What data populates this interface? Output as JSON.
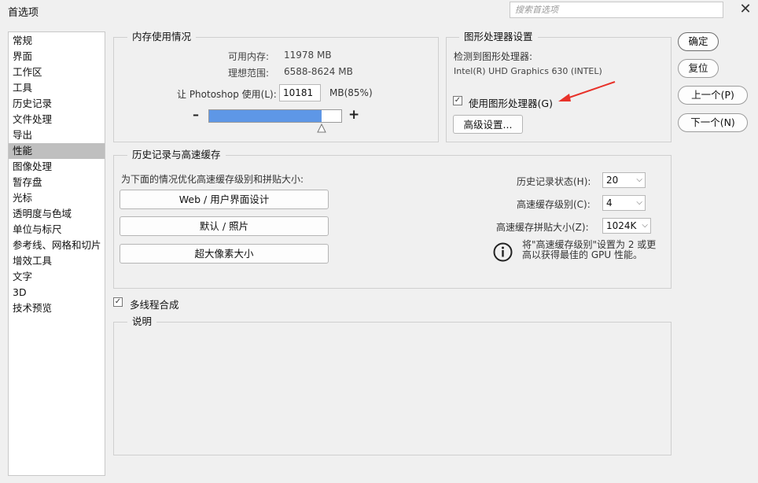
{
  "window": {
    "title": "首选项",
    "search_placeholder": "搜索首选项",
    "close_glyph": "✕"
  },
  "sidebar": {
    "items": [
      {
        "label": "常规"
      },
      {
        "label": "界面"
      },
      {
        "label": "工作区"
      },
      {
        "label": "工具"
      },
      {
        "label": "历史记录"
      },
      {
        "label": "文件处理"
      },
      {
        "label": "导出"
      },
      {
        "label": "性能",
        "selected": true
      },
      {
        "label": "图像处理"
      },
      {
        "label": "暂存盘"
      },
      {
        "label": "光标"
      },
      {
        "label": "透明度与色域"
      },
      {
        "label": "单位与标尺"
      },
      {
        "label": "参考线、网格和切片"
      },
      {
        "label": "增效工具"
      },
      {
        "label": "文字"
      },
      {
        "label": "3D"
      },
      {
        "label": "技术预览"
      }
    ]
  },
  "memory": {
    "title": "内存使用情况",
    "available_label": "可用内存:",
    "available_value": "11978 MB",
    "ideal_label": "理想范围:",
    "ideal_value": "6588-8624 MB",
    "let_label": "让 Photoshop 使用(L):",
    "let_value": "10181",
    "let_unit": "MB(85%)",
    "slider_fraction": 0.85,
    "minus": "–",
    "plus": "+"
  },
  "gpu": {
    "title": "图形处理器设置",
    "detected_label": "检测到图形处理器:",
    "gpu_name": "Intel(R) UHD Graphics 630 (INTEL)",
    "use_gpu_label": "使用图形处理器(G)",
    "use_gpu_checked": true,
    "advanced_button": "高级设置..."
  },
  "history_cache": {
    "title": "历史记录与高速缓存",
    "optimize_label": "为下面的情况优化高速缓存级别和拼贴大小:",
    "buttons": [
      "Web / 用户界面设计",
      "默认 / 照片",
      "超大像素大小"
    ],
    "history_states_label": "历史记录状态(H):",
    "history_states_value": "20",
    "cache_levels_label": "高速缓存级别(C):",
    "cache_levels_value": "4",
    "cache_tile_label": "高速缓存拼贴大小(Z):",
    "cache_tile_value": "1024K",
    "info_line1": "将\"高速缓存级别\"设置为 2 或更",
    "info_line2": "高以获得最佳的 GPU 性能。"
  },
  "multithread": {
    "label": "多线程合成",
    "checked": true
  },
  "description": {
    "title": "说明"
  },
  "actions": {
    "ok": "确定",
    "reset": "复位",
    "prev": "上一个(P)",
    "next": "下一个(N)"
  },
  "colors": {
    "slider_fill": "#5e97e6",
    "arrow": "#e8322a",
    "selected_item": "#bfbfbf"
  }
}
